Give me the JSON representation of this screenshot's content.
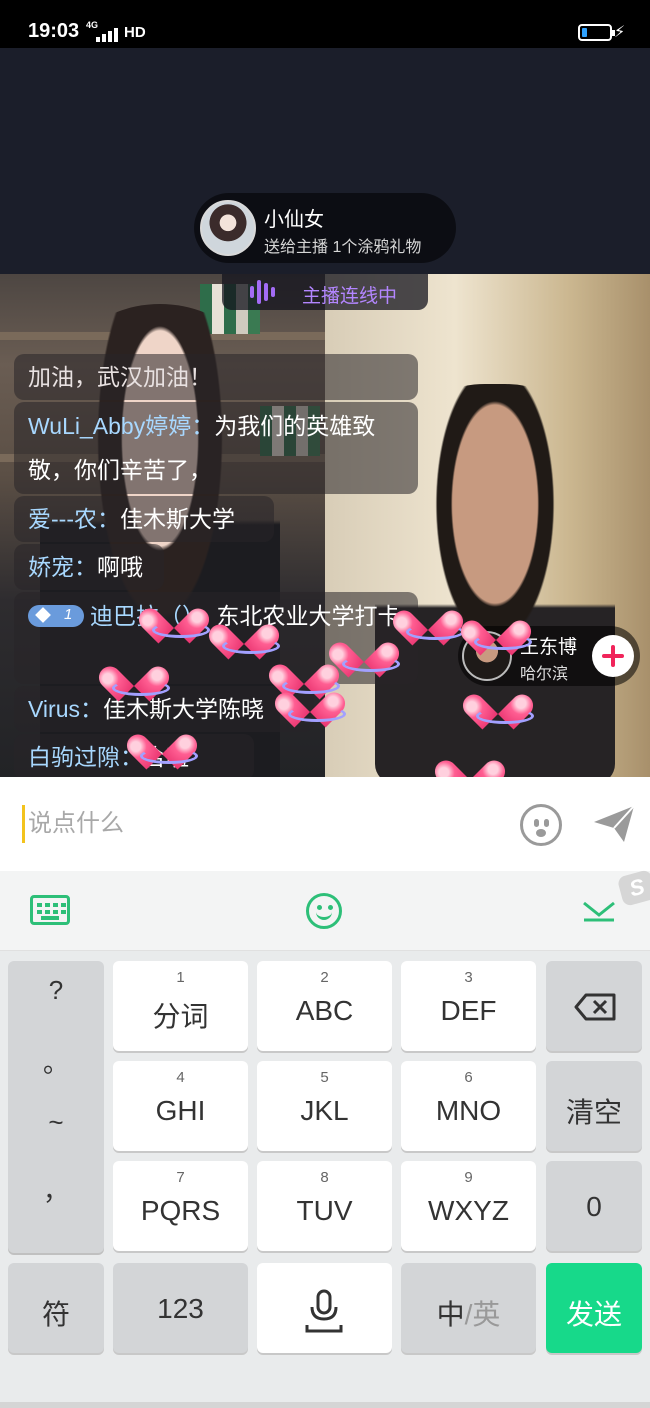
{
  "status_bar": {
    "time": "19:03",
    "network": "4G",
    "hd": "HD"
  },
  "gift_notice": {
    "sender": "小仙女",
    "message": "送给主播 1个涂鸦礼物"
  },
  "link_banner": {
    "text": "主播连线中"
  },
  "chat": [
    {
      "user": "",
      "text": "加油，武汉加油！"
    },
    {
      "user": "WuLi_Abby婷婷：",
      "text": "为我们的英雄致敬，你们辛苦了，"
    },
    {
      "user": "爱---农：",
      "text": "佳木斯大学"
    },
    {
      "user": "娇宠：",
      "text": "啊哦"
    },
    {
      "badge_level": "1",
      "user": "迪巴拉（）：",
      "text": "东北农业大学打卡"
    },
    {
      "user": "Virus：",
      "text": "佳木斯大学陈晓"
    },
    {
      "user": "白驹过隙：",
      "text": "合啦"
    }
  ],
  "anchor_card": {
    "name": "王东博",
    "city": "哈尔滨"
  },
  "input": {
    "placeholder": "说点什么"
  },
  "keyboard": {
    "symbols": [
      "?",
      "。",
      "~",
      "，"
    ],
    "keys": [
      {
        "num": "1",
        "label": "分词"
      },
      {
        "num": "2",
        "label": "ABC"
      },
      {
        "num": "3",
        "label": "DEF"
      },
      {
        "num": "4",
        "label": "GHI"
      },
      {
        "num": "5",
        "label": "JKL"
      },
      {
        "num": "6",
        "label": "MNO"
      },
      {
        "num": "7",
        "label": "PQRS"
      },
      {
        "num": "8",
        "label": "TUV"
      },
      {
        "num": "9",
        "label": "WXYZ"
      }
    ],
    "clear_label": "清空",
    "zero_label": "0",
    "symbol_label": "符",
    "num_label": "123",
    "lang_zh": "中",
    "lang_sep": "/",
    "lang_en": "英",
    "send_label": "发送",
    "logo_letter": "S"
  },
  "colors": {
    "accent_green": "#17d98a",
    "link_purple": "#b386ff",
    "username_blue": "#a8d8ff"
  }
}
